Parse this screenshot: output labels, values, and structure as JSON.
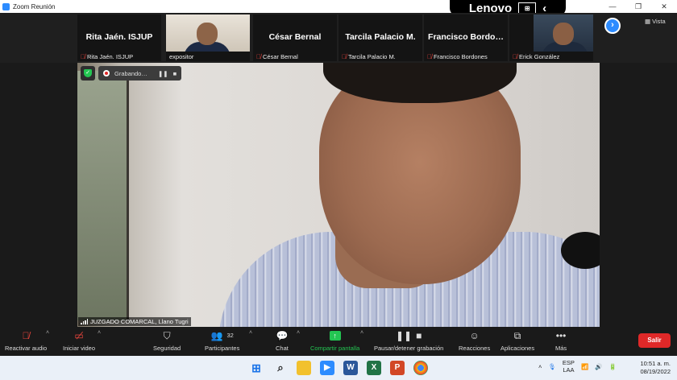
{
  "window": {
    "title": "Zoom Reunión",
    "controls": [
      "—",
      "❐",
      "✕"
    ]
  },
  "lenovo": {
    "brand": "Lenovo"
  },
  "gallery": {
    "tiles": [
      {
        "display_name": "Rita Jaén. ISJUP",
        "label": "Rita Jaén. ISJUP",
        "muted": true
      },
      {
        "display_name": "",
        "label": "expositor",
        "muted": false
      },
      {
        "display_name": "César Bernal",
        "label": "César Bernal",
        "muted": true
      },
      {
        "display_name": "Tarcila Palacio M.",
        "label": "Tarcila Palacio M.",
        "muted": true
      },
      {
        "display_name": "Francisco  Bordo…",
        "label": "Francisco Bordones",
        "muted": true
      },
      {
        "display_name": "",
        "label": "Erick González",
        "muted": true
      }
    ],
    "view_label": "Vista"
  },
  "recording": {
    "status": "Grabando…"
  },
  "speaker": {
    "name": "JUZGADO COMARCAL, Llano Tugri"
  },
  "toolbar": {
    "audio": "Reactivar audio",
    "video": "Iniciar video",
    "security": "Seguridad",
    "participants": "Participantes",
    "participants_count": "32",
    "chat": "Chat",
    "share": "Compartir pantalla",
    "record": "Pausar/detener grabación",
    "reactions": "Reacciones",
    "apps": "Aplicaciones",
    "more": "Más",
    "leave": "Salir"
  },
  "taskbar": {
    "language_line1": "ESP",
    "language_line2": "LAA",
    "time": "10:51 a. m.",
    "date": "08/19/2022"
  },
  "colors": {
    "accent": "#2d8cff",
    "danger": "#e02828",
    "share": "#23c552"
  }
}
